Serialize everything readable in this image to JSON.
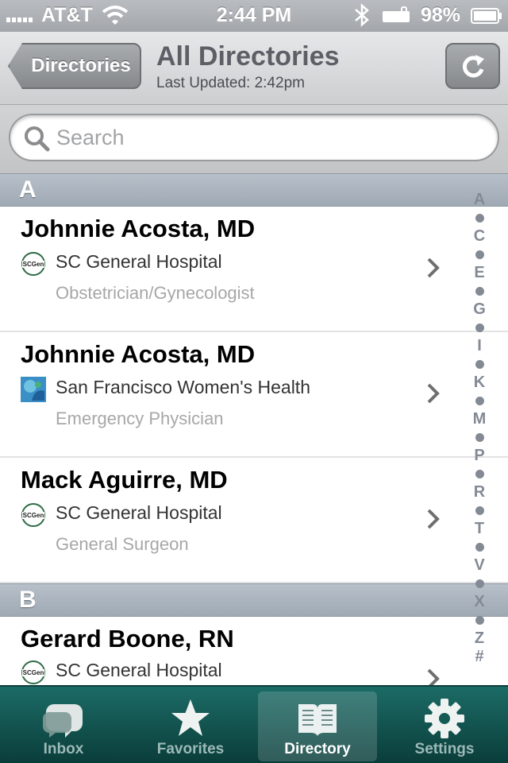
{
  "status_bar": {
    "carrier": "AT&T",
    "time": "2:44 PM",
    "battery_percent": "98%"
  },
  "nav": {
    "back_label": "Directories",
    "title": "All Directories",
    "subtitle": "Last Updated: 2:42pm"
  },
  "search": {
    "placeholder": "Search"
  },
  "sections": [
    {
      "letter": "A",
      "rows": [
        {
          "name": "Johnnie Acosta, MD",
          "org": "SC General Hospital",
          "org_icon": "sc-general-logo",
          "specialty": "Obstetrician/Gynecologist"
        },
        {
          "name": "Johnnie Acosta, MD",
          "org": "San Francisco Women's Health",
          "org_icon": "sf-womens-health-logo",
          "specialty": "Emergency Physician"
        },
        {
          "name": "Mack Aguirre, MD",
          "org": "SC General Hospital",
          "org_icon": "sc-general-logo",
          "specialty": "General Surgeon"
        }
      ]
    },
    {
      "letter": "B",
      "rows": [
        {
          "name": "Gerard Boone, RN",
          "org": "SC General Hospital",
          "org_icon": "sc-general-logo",
          "specialty": ""
        }
      ]
    }
  ],
  "index": [
    "A",
    "C",
    "E",
    "G",
    "I",
    "K",
    "M",
    "P",
    "R",
    "T",
    "V",
    "X",
    "Z",
    "#"
  ],
  "logo_text": "SCGen",
  "tabs": [
    {
      "label": "Inbox",
      "icon": "speech-bubble-icon",
      "active": false
    },
    {
      "label": "Favorites",
      "icon": "star-icon",
      "active": false
    },
    {
      "label": "Directory",
      "icon": "book-icon",
      "active": true
    },
    {
      "label": "Settings",
      "icon": "gear-icon",
      "active": false
    }
  ],
  "colors": {
    "tab_bar": "#0f4d49",
    "section_header": "#a9b2bc",
    "index_text": "#838a94"
  }
}
